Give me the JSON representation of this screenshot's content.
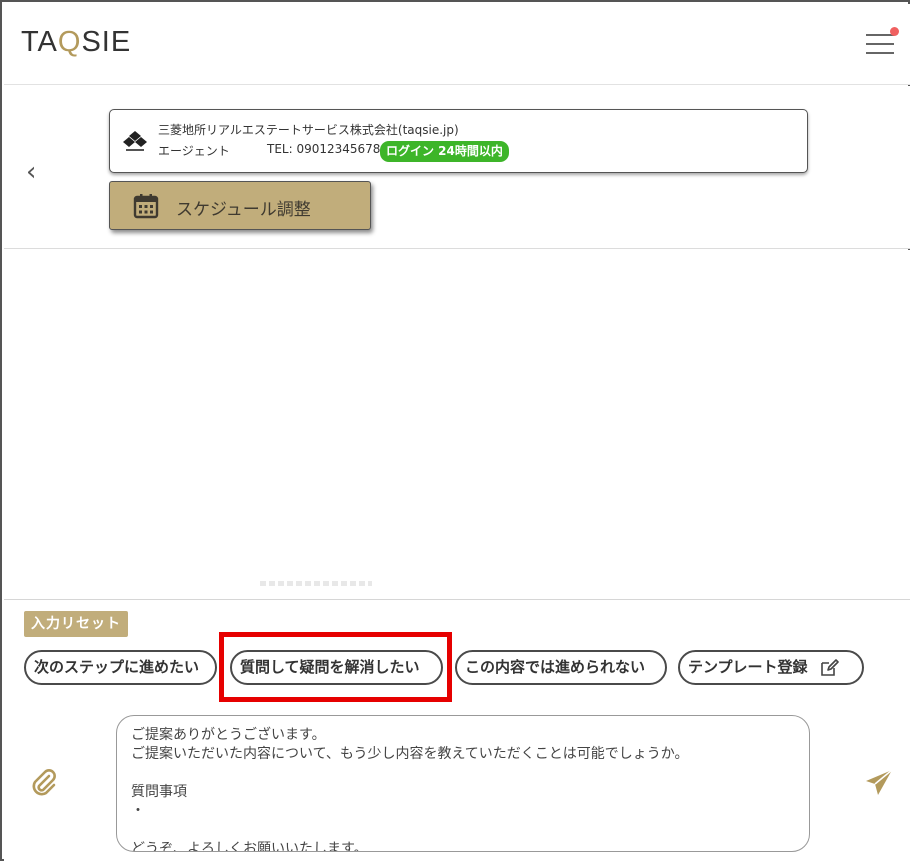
{
  "header": {
    "logo_prefix": "TA",
    "logo_q": "Q",
    "logo_suffix": "SIE",
    "menu_icon": "hamburger-menu-icon",
    "notification_dot_color": "#f06060"
  },
  "subhead": {
    "back_icon": "chevron-left-icon",
    "back_glyph": "‹",
    "agent": {
      "company_name": "三菱地所リアルエステートサービス株式会社(taqsie.jp)",
      "role": "エージェント",
      "tel": "TEL: 09012345678",
      "login_badge": "ログイン 24時間以内",
      "login_badge_color": "#3db529"
    },
    "schedule_button": {
      "label": "スケジュール調整",
      "icon": "calendar-icon"
    }
  },
  "composer": {
    "reset_label": "入力リセット",
    "chips": [
      {
        "label": "次のステップに進めたい"
      },
      {
        "label": "質問して疑問を解消したい",
        "highlighted": true
      },
      {
        "label": "この内容では進められない"
      },
      {
        "label": "テンプレート登録",
        "icon": "edit-icon"
      }
    ],
    "attach_icon": "paperclip-icon",
    "send_icon": "send-icon",
    "message_lines": [
      "ご提案ありがとうございます。",
      "ご提案いただいた内容について、もう少し内容を教えていただくことは可能でしょうか。",
      "",
      "質問事項",
      "・",
      "",
      "どうぞ、よろしくお願いいたします。"
    ]
  },
  "colors": {
    "brand_gold": "#c1ad7b",
    "highlight_red": "#e60000"
  }
}
